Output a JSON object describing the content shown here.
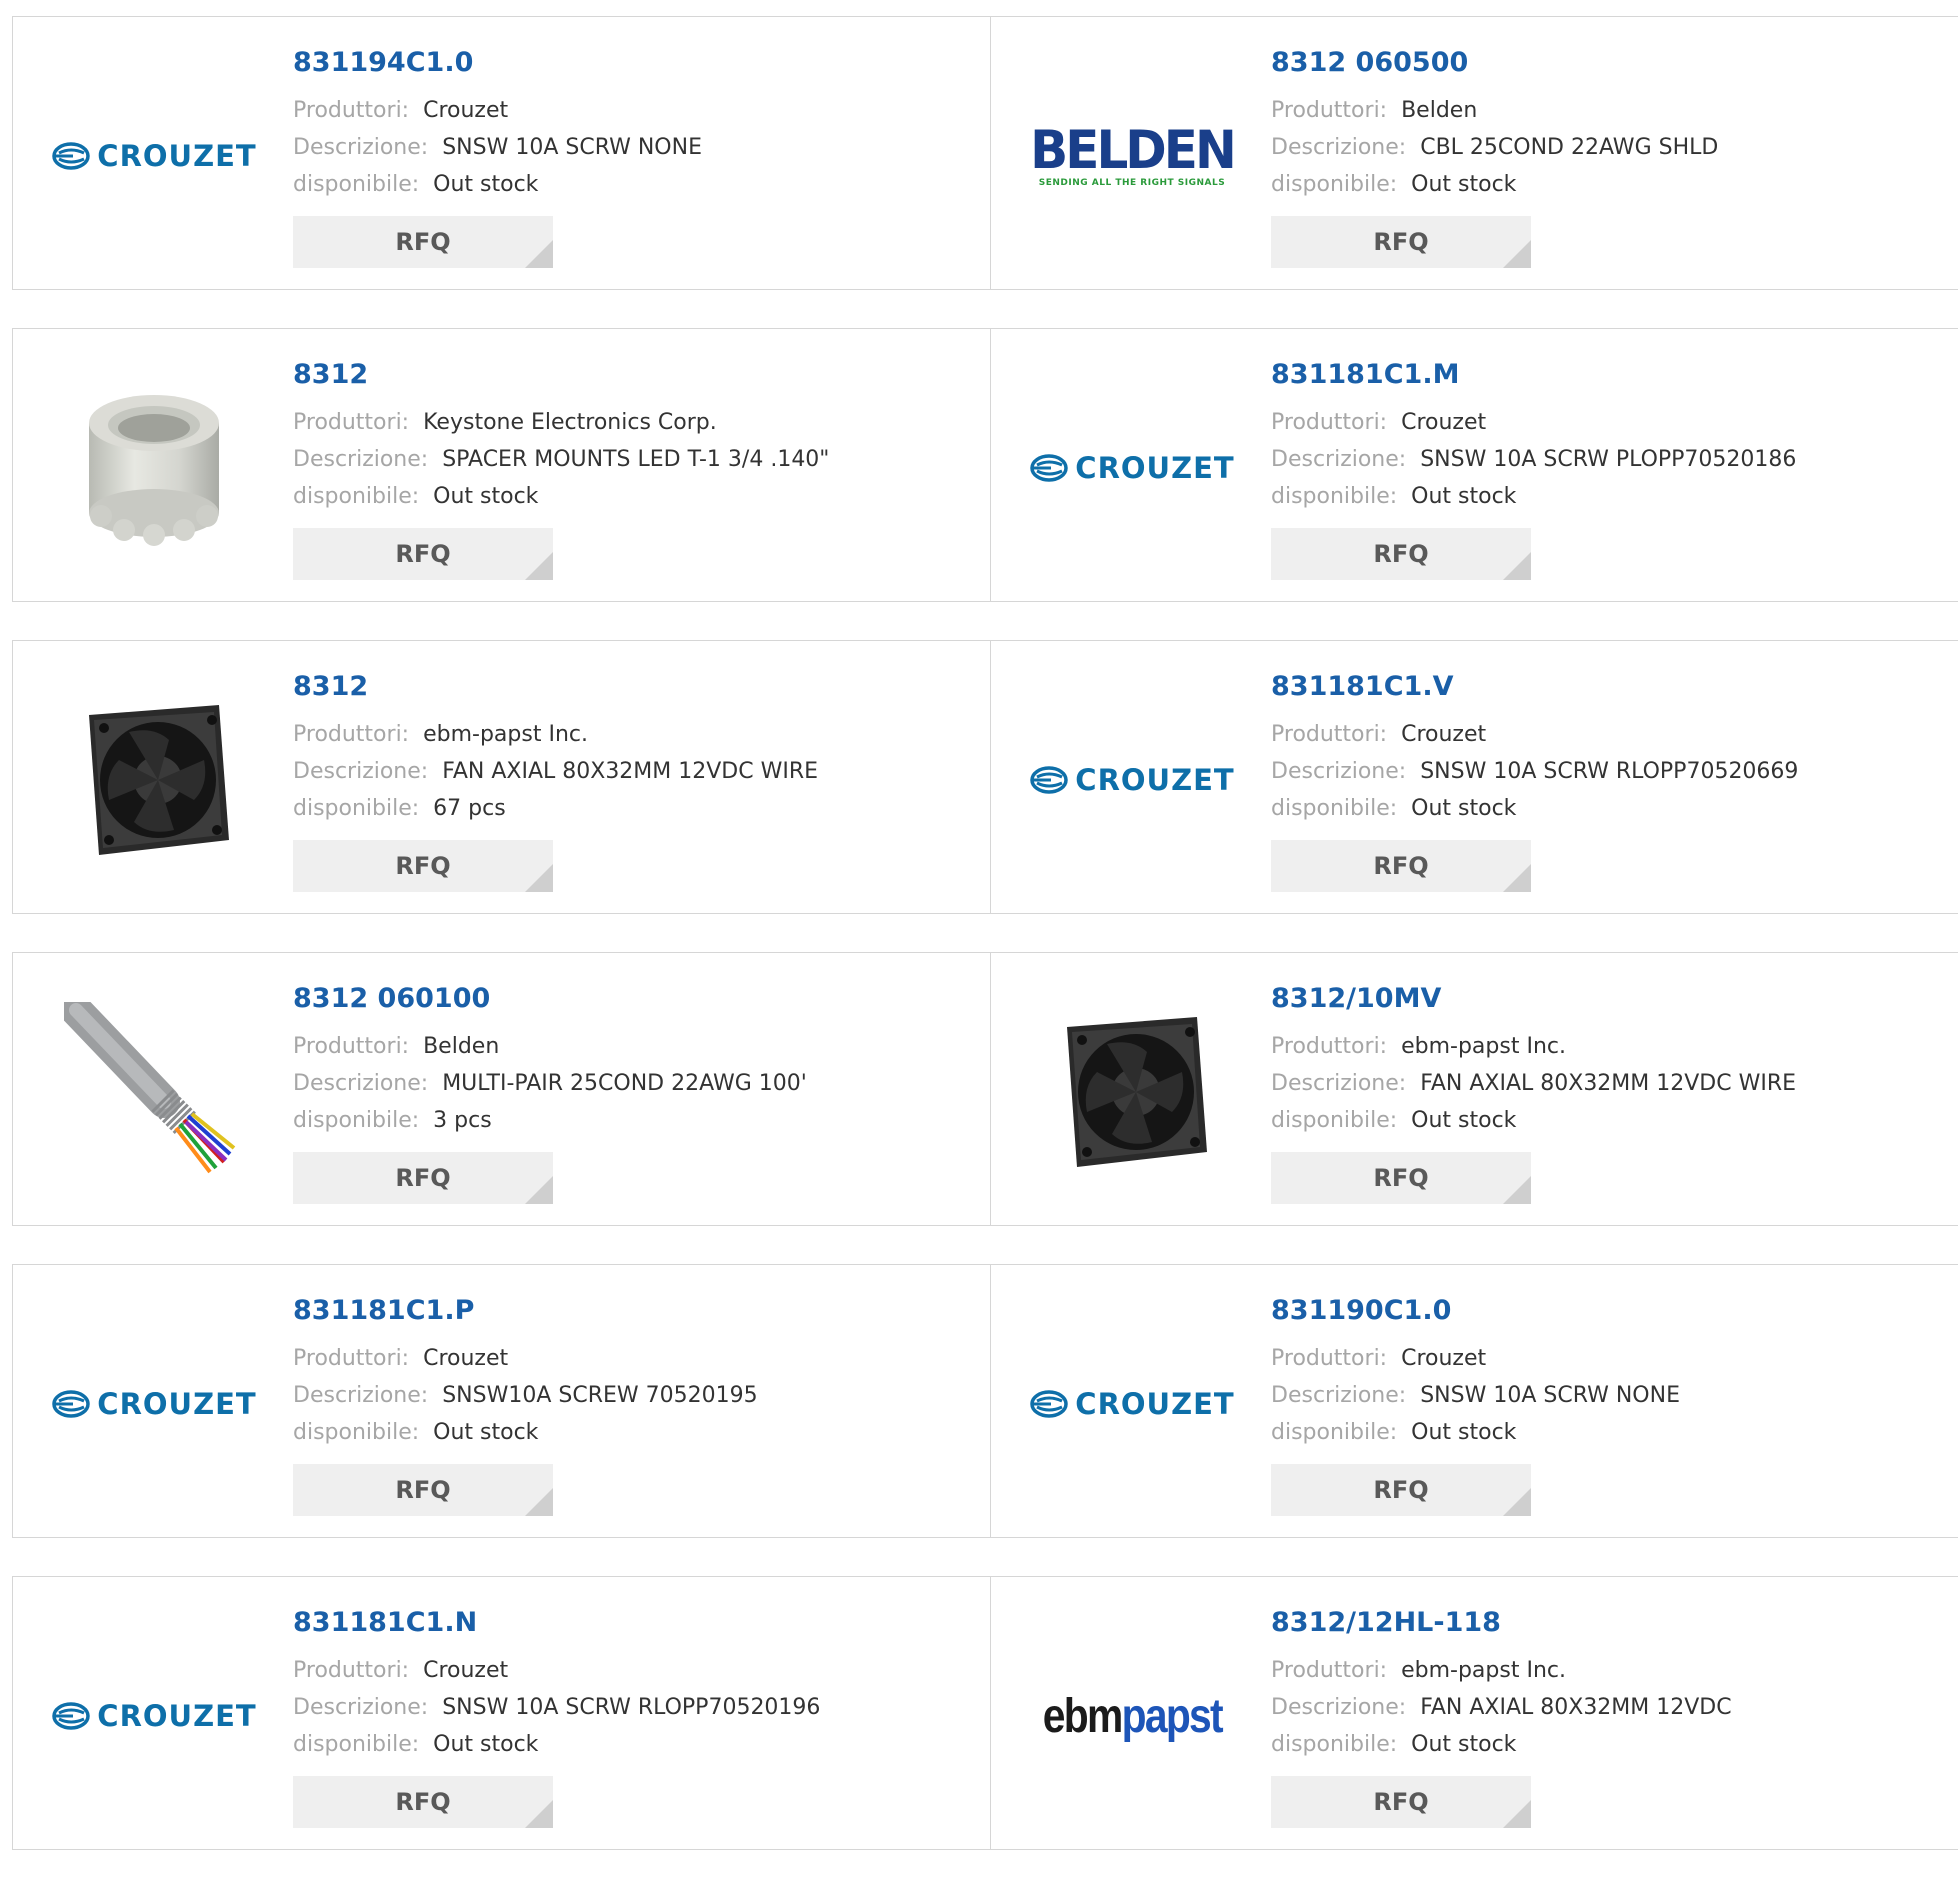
{
  "labels": {
    "manufacturer": "Produttori:",
    "description": "Descrizione:",
    "availability": "disponibile:",
    "rfq": "RFQ"
  },
  "products": [
    {
      "part": "831194C1.0",
      "manufacturer": "Crouzet",
      "description": "SNSW 10A SCRW NONE",
      "availability": "Out stock",
      "thumb": "crouzet-logo",
      "logo_text": "CROUZET"
    },
    {
      "part": "8312 060500",
      "manufacturer": "Belden",
      "description": "CBL 25COND 22AWG SHLD",
      "availability": "Out stock",
      "thumb": "belden-logo",
      "logo_text": "BELDEN",
      "logo_tagline": "SENDING ALL THE RIGHT SIGNALS"
    },
    {
      "part": "8312",
      "manufacturer": "Keystone Electronics Corp.",
      "description": "SPACER MOUNTS LED T-1 3/4 .140\"",
      "availability": "Out stock",
      "thumb": "spacer-photo"
    },
    {
      "part": "831181C1.M",
      "manufacturer": "Crouzet",
      "description": "SNSW 10A SCRW PLOPP70520186",
      "availability": "Out stock",
      "thumb": "crouzet-logo",
      "logo_text": "CROUZET"
    },
    {
      "part": "8312",
      "manufacturer": "ebm-papst Inc.",
      "description": "FAN AXIAL 80X32MM 12VDC WIRE",
      "availability": "67 pcs",
      "thumb": "fan-photo"
    },
    {
      "part": "831181C1.V",
      "manufacturer": "Crouzet",
      "description": "SNSW 10A SCRW RLOPP70520669",
      "availability": "Out stock",
      "thumb": "crouzet-logo",
      "logo_text": "CROUZET"
    },
    {
      "part": "8312 060100",
      "manufacturer": "Belden",
      "description": "MULTI-PAIR 25COND 22AWG 100'",
      "availability": "3 pcs",
      "thumb": "cable-photo"
    },
    {
      "part": "8312/10MV",
      "manufacturer": "ebm-papst Inc.",
      "description": "FAN AXIAL 80X32MM 12VDC WIRE",
      "availability": "Out stock",
      "thumb": "fan-photo"
    },
    {
      "part": "831181C1.P",
      "manufacturer": "Crouzet",
      "description": "SNSW10A SCREW 70520195",
      "availability": "Out stock",
      "thumb": "crouzet-logo",
      "logo_text": "CROUZET"
    },
    {
      "part": "831190C1.0",
      "manufacturer": "Crouzet",
      "description": "SNSW 10A SCRW NONE",
      "availability": "Out stock",
      "thumb": "crouzet-logo",
      "logo_text": "CROUZET"
    },
    {
      "part": "831181C1.N",
      "manufacturer": "Crouzet",
      "description": "SNSW 10A SCRW RLOPP70520196",
      "availability": "Out stock",
      "thumb": "crouzet-logo",
      "logo_text": "CROUZET"
    },
    {
      "part": "8312/12HL-118",
      "manufacturer": "ebm-papst Inc.",
      "description": "FAN AXIAL 80X32MM 12VDC",
      "availability": "Out stock",
      "thumb": "ebmpapst-logo",
      "logo_text_1": "ebm",
      "logo_text_2": "papst"
    }
  ],
  "colors": {
    "part_link": "#1a5fa8",
    "label": "#a6a6a6",
    "value": "#333333",
    "rfq_bg": "#efefef",
    "border": "#d6d6d6"
  }
}
